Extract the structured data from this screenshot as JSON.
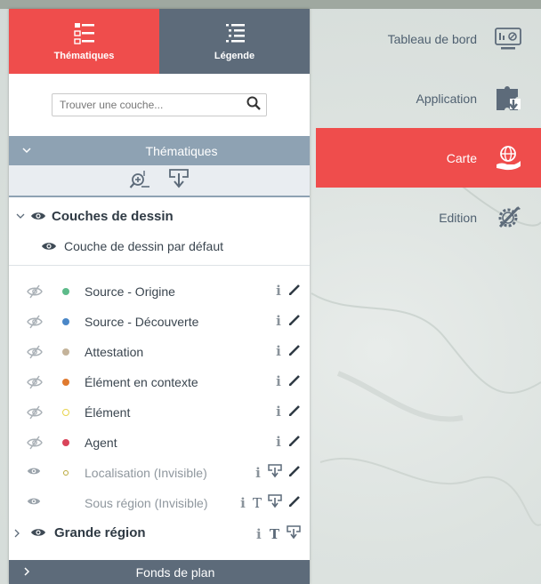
{
  "tabs": [
    {
      "label": "Thématiques",
      "icon": "thematic-list-icon",
      "active": true
    },
    {
      "label": "Légende",
      "icon": "legend-list-icon",
      "active": false
    }
  ],
  "search": {
    "placeholder": "Trouver une couche..."
  },
  "thematics_header": {
    "title": "Thématiques"
  },
  "draw_group": {
    "label": "Couches de dessin",
    "default_layer": "Couche de dessin par défaut"
  },
  "layers": [
    {
      "name": "Source - Origine",
      "color": "#5dbb8a",
      "visible": false
    },
    {
      "name": "Source - Découverte",
      "color": "#4a87c7",
      "visible": false
    },
    {
      "name": "Attestation",
      "color": "#c4b39a",
      "visible": false
    },
    {
      "name": "Élément en contexte",
      "color": "#e07a2f",
      "visible": false
    },
    {
      "name": "Élément",
      "color": "#e8d44d",
      "visible": false
    },
    {
      "name": "Agent",
      "color": "#d9445a",
      "visible": false
    },
    {
      "name": "Localisation (Invisible)",
      "color": "#b9a83a",
      "visible": true
    },
    {
      "name": "Sous région (Invisible)",
      "color": "",
      "visible": true
    }
  ],
  "region_group": {
    "label": "Grande région"
  },
  "basemaps_header": {
    "title": "Fonds de plan"
  },
  "nav": [
    {
      "label": "Tableau de bord",
      "icon": "dashboard-monitor-icon",
      "active": false
    },
    {
      "label": "Application",
      "icon": "application-puzzle-icon",
      "active": false
    },
    {
      "label": "Carte",
      "icon": "map-globe-hand-icon",
      "active": true
    },
    {
      "label": "Edition",
      "icon": "edition-gear-pencil-icon",
      "active": false
    }
  ],
  "colors": {
    "accent": "#ef4d4c",
    "header": "#8ea2b3",
    "dark": "#5d6b7a"
  }
}
